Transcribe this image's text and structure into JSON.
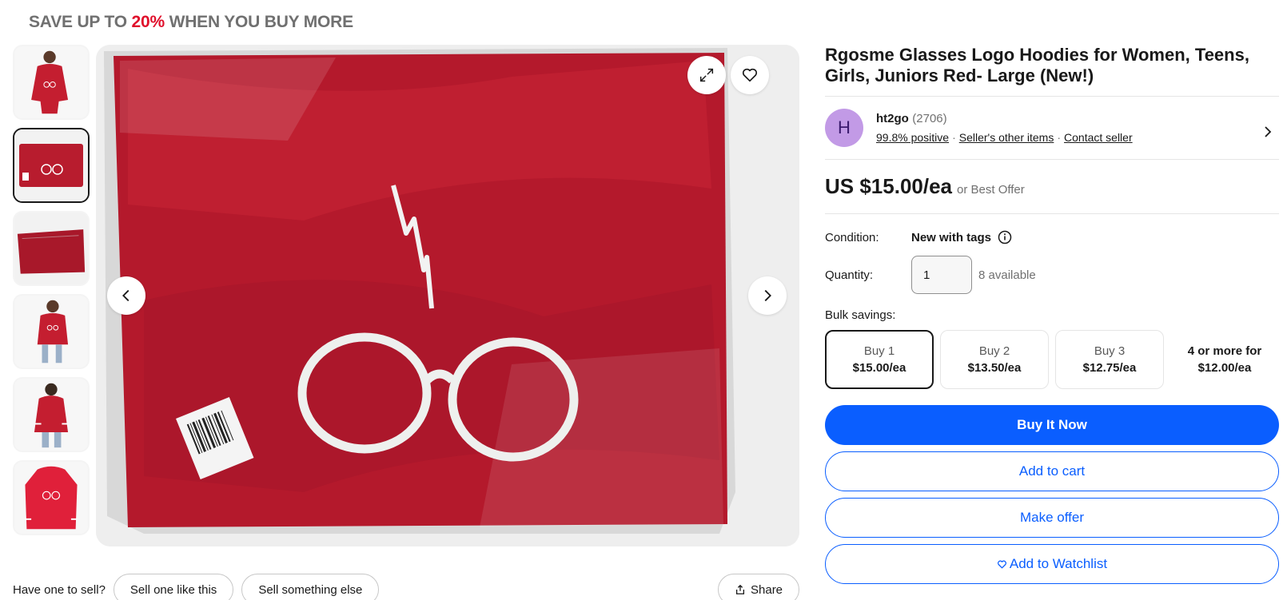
{
  "promo": {
    "prefix": "SAVE UP TO ",
    "percent": "20%",
    "suffix": " WHEN YOU BUY MORE"
  },
  "gallery": {
    "thumbnails": [
      "red-hoodie-model-front",
      "red-hoodie-packaged-active",
      "red-hoodie-packaged-side",
      "red-hoodie-model-pocket",
      "red-hoodie-model-back",
      "red-hoodie-flat"
    ],
    "active_index": 1,
    "icons": {
      "expand": "expand-icon",
      "favorite": "heart-icon",
      "prev": "chevron-left-icon",
      "next": "chevron-right-icon"
    }
  },
  "sell": {
    "label": "Have one to sell?",
    "like_this": "Sell one like this",
    "something_else": "Sell something else",
    "share": "Share"
  },
  "listing": {
    "title": "Rgosme Glasses Logo Hoodies for Women, Teens, Girls, Juniors Red- Large (New!)",
    "seller": {
      "initial": "H",
      "name": "ht2go",
      "feedback_count": "(2706)",
      "positive": "99.8% positive",
      "other_items": "Seller's other items",
      "contact": "Contact seller"
    },
    "price": "US $15.00/ea",
    "best_offer": "or Best Offer",
    "condition_label": "Condition:",
    "condition_value": "New with tags",
    "quantity_label": "Quantity:",
    "quantity_value": "1",
    "available": "8 available",
    "bulk_label": "Bulk savings:",
    "tiers": [
      {
        "qty": "Buy 1",
        "price": "$15.00/ea"
      },
      {
        "qty": "Buy 2",
        "price": "$13.50/ea"
      },
      {
        "qty": "Buy 3",
        "price": "$12.75/ea"
      },
      {
        "qty": "4 or more for",
        "price": "$12.00/ea"
      }
    ],
    "buy_now": "Buy It Now",
    "add_to_cart": "Add to cart",
    "make_offer": "Make offer",
    "watchlist": "Add to Watchlist"
  },
  "colors": {
    "accent": "#0a5eff",
    "promo_red": "#e0102b",
    "product_red": "#b81c2e",
    "avatar": "#c29ae6"
  }
}
